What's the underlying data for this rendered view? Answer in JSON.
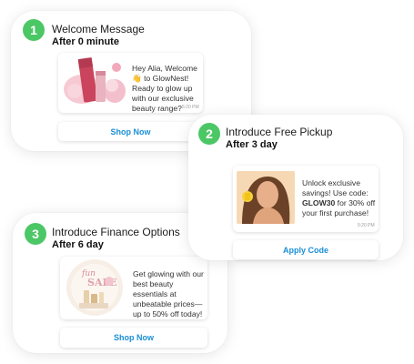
{
  "cards": [
    {
      "step": "1",
      "title": "Welcome Message",
      "timing": "After 0 minute",
      "message": "Hey Alia, Welcome 👋 to GlowNest! Ready to glow up with our exclusive beauty range?",
      "time": "5:20 PM",
      "button": "Shop Now",
      "image_icon": "skincare-product-image"
    },
    {
      "step": "2",
      "title": "Introduce Free Pickup",
      "timing": "After 3 day",
      "message_pre": "Unlock exclusive savings! Use code: ",
      "message_code": "GLOW30",
      "message_post": " for 30% off your first purchase!",
      "time": "5:20 PM",
      "button": "Apply Code",
      "image_icon": "model-portrait-image"
    },
    {
      "step": "3",
      "title": "Introduce Finance Options",
      "timing": "After 6 day",
      "message": "Get glowing with our best beauty essentials at unbeatable prices—up to 50% off today!",
      "button": "Shop Now",
      "image_icon": "sale-banner-image"
    }
  ],
  "colors": {
    "badge": "#4cc766",
    "link": "#1a8fd6"
  }
}
